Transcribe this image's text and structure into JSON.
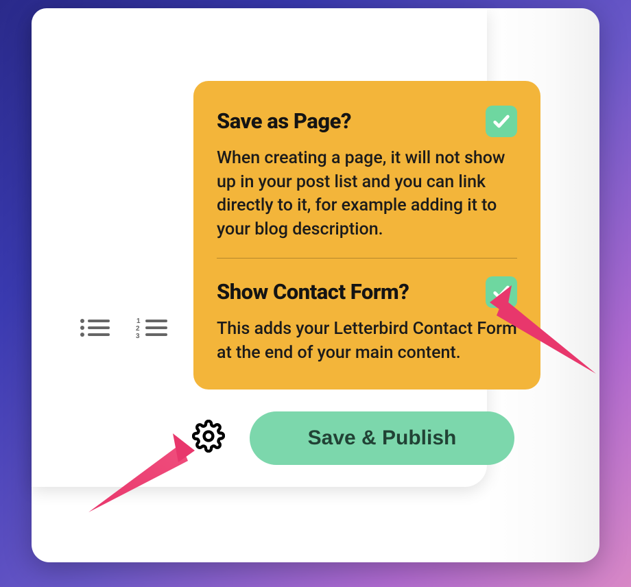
{
  "popover": {
    "saveAsPage": {
      "title": "Save as Page?",
      "description": "When creating a page, it will not show up in your post list and you can link directly to it, for example adding it to your blog description.",
      "checked": true
    },
    "showContactForm": {
      "title": "Show Contact Form?",
      "description": "This adds your Letterbird Contact Form at the end of your main content.",
      "checked": true
    }
  },
  "buttons": {
    "publish": "Save & Publish"
  },
  "colors": {
    "popoverBg": "#f3b53a",
    "accentGreen": "#7cd7ac",
    "toggleGreen": "#6ed7a0",
    "arrow": "#e8376c"
  }
}
